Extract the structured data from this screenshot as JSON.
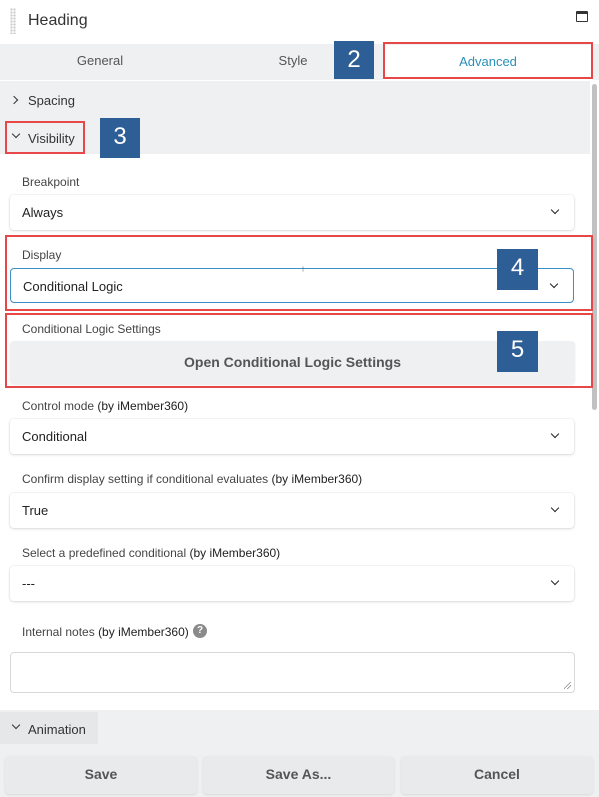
{
  "panel": {
    "title": "Heading",
    "window_icon": "maximize-window-icon"
  },
  "tabs": [
    {
      "label": "General"
    },
    {
      "label": "Style"
    },
    {
      "label": "Advanced",
      "active": true
    }
  ],
  "sections": {
    "spacing": {
      "label": "Spacing",
      "expanded": false
    },
    "visibility": {
      "label": "Visibility",
      "expanded": true
    },
    "animation": {
      "label": "Animation",
      "expanded": true
    }
  },
  "fields": {
    "breakpoint": {
      "label": "Breakpoint",
      "value": "Always"
    },
    "display": {
      "label": "Display",
      "value": "Conditional Logic"
    },
    "conditional_logic_settings": {
      "label": "Conditional Logic Settings",
      "button": "Open Conditional Logic Settings"
    },
    "control_mode": {
      "label": "Control mode",
      "by": "(by iMember360)",
      "value": "Conditional"
    },
    "confirm_display": {
      "label": "Confirm display setting if conditional evaluates",
      "by": "(by iMember360)",
      "value": "True"
    },
    "predefined_conditional": {
      "label": "Select a predefined conditional",
      "by": "(by iMember360)",
      "value": "---"
    },
    "internal_notes": {
      "label": "Internal notes",
      "by": "(by iMember360)",
      "value": "",
      "help_icon": "question-icon"
    }
  },
  "footer": {
    "save": "Save",
    "save_as": "Save As...",
    "cancel": "Cancel"
  },
  "annotations": [
    {
      "number": "2"
    },
    {
      "number": "3"
    },
    {
      "number": "4"
    },
    {
      "number": "5"
    }
  ],
  "colors": {
    "accent": "#2a8fb8",
    "highlight_box": "#e8474a",
    "badge": "#2e5e96",
    "panel_bg": "#eff0f2"
  }
}
